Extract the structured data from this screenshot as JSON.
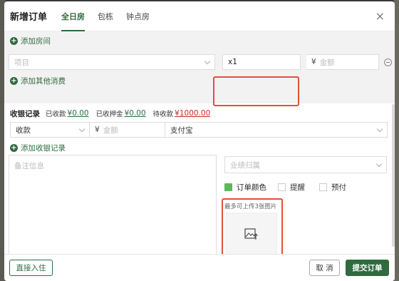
{
  "modal": {
    "title": "新增订单",
    "tabs": [
      {
        "label": "全日房"
      },
      {
        "label": "包栋"
      },
      {
        "label": "钟点房"
      }
    ],
    "close_glyph": "×"
  },
  "room": {
    "add_room": "添加房间",
    "item_placeholder": "项目",
    "qty_value": "x1",
    "currency": "¥",
    "amount_placeholder": "金额",
    "add_other": "添加其他消费"
  },
  "cashier": {
    "title": "收银记录",
    "received_label": "已收款",
    "received_value": "¥0.00",
    "deposit_label": "已收押金",
    "deposit_value": "¥0.00",
    "pending_label": "待收款",
    "pending_value": "¥1000.00",
    "type_value": "收款",
    "currency": "¥",
    "amount_placeholder": "金额",
    "method_value": "支付宝",
    "add_record": "添加收银记录"
  },
  "notes": {
    "placeholder": "备注信息"
  },
  "side": {
    "performance_placeholder": "业绩归属",
    "order_color": "订单颜色",
    "remind": "提醒",
    "prepay": "预付",
    "upload_hint": "最多可上传3张图片",
    "order_color_hex": "#5cb85c"
  },
  "footer": {
    "checkin": "直接入住",
    "cancel": "取 消",
    "submit": "提交订单"
  }
}
